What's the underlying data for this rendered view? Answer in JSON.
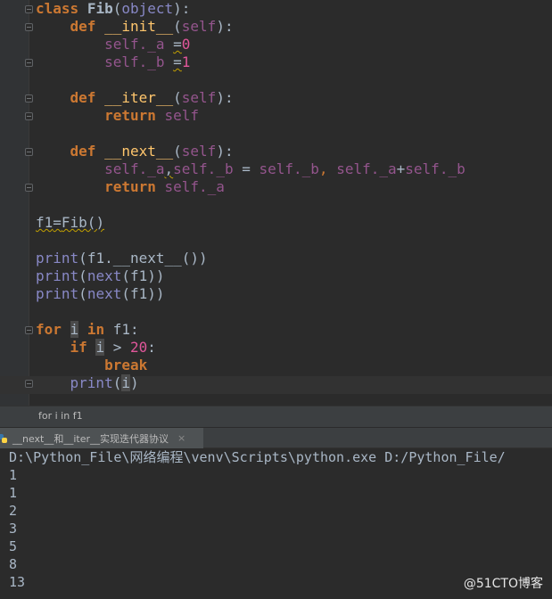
{
  "editor": {
    "code": {
      "class_kw": "class",
      "class_name": "Fib",
      "class_base": "object",
      "def_kw": "def",
      "init_name": "__init__",
      "iter_name": "__iter__",
      "next_name": "__next__",
      "self": "self",
      "attr_a": "_a",
      "attr_b": "_b",
      "zero": "0",
      "one": "1",
      "return_kw": "return",
      "f1_line_var": "f1",
      "f1_line_call": "Fib()",
      "print_kw": "print",
      "next_kw": "next",
      "f1": "f1",
      "for_kw": "for",
      "in_kw": "in",
      "i": "i",
      "if_kw": "if",
      "twenty": "20",
      "break_kw": "break"
    }
  },
  "breadcrumb": "for i in f1",
  "run_tab": {
    "label": "__next__和__iter__实现迭代器协议",
    "close": "×"
  },
  "console": {
    "command": "D:\\Python_File\\网络编程\\venv\\Scripts\\python.exe D:/Python_File/",
    "output": [
      "1",
      "1",
      "2",
      "3",
      "5",
      "8",
      "13"
    ]
  },
  "watermark": "@51CTO博客",
  "colors": {
    "background": "#2b2b2b",
    "keyword": "#cc7832",
    "function": "#ffc66d",
    "self": "#94558d",
    "number": "#e0569a",
    "builtin": "#8888c6",
    "text": "#a9b7c6"
  }
}
